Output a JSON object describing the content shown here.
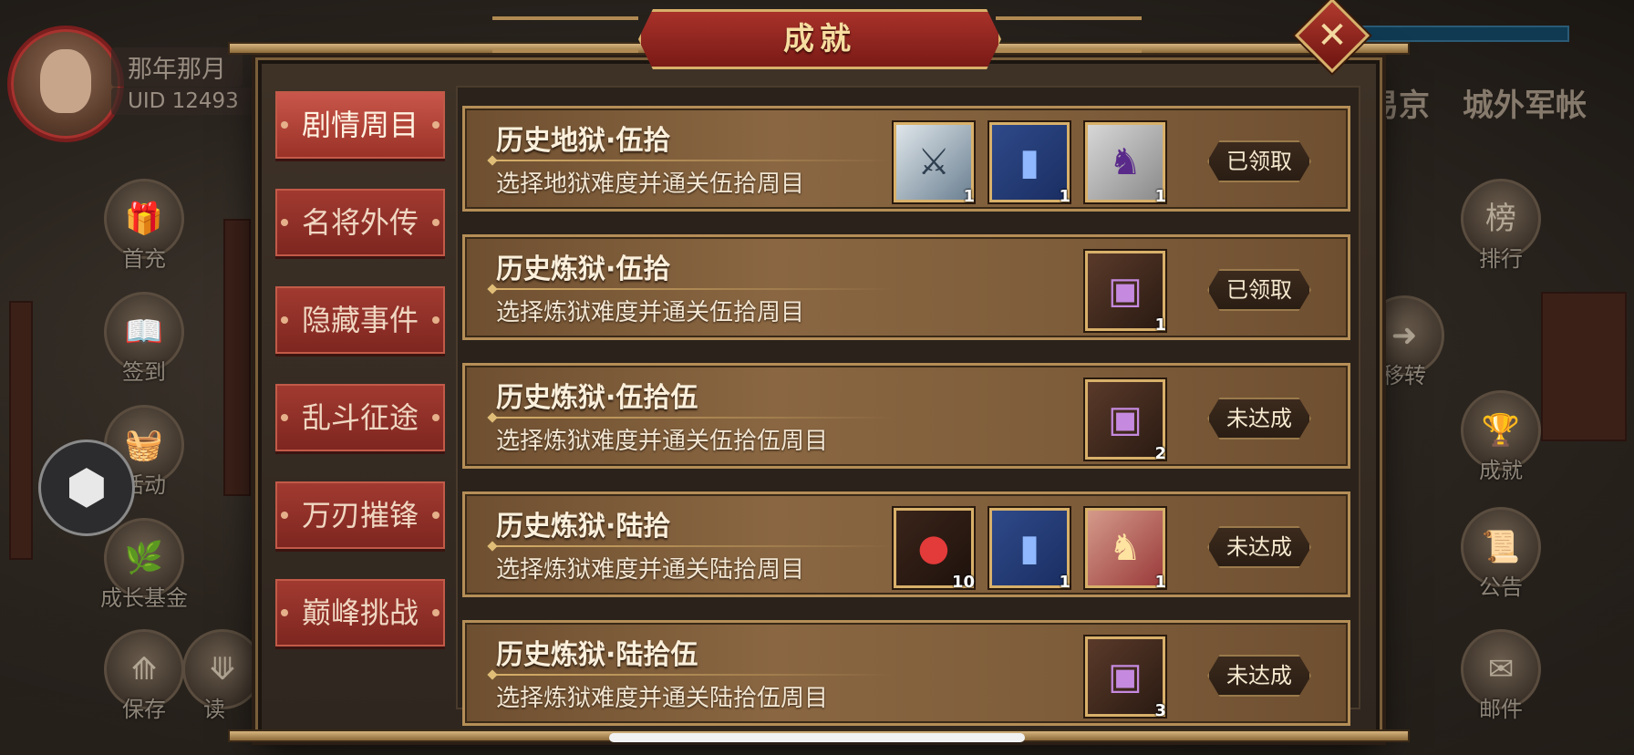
{
  "player": {
    "name": "那年那月",
    "uid": "UID  12493"
  },
  "background": {
    "locations": [
      "易京",
      "城外军帐"
    ],
    "left_menu": [
      {
        "label": "首充",
        "icon": "gift-icon"
      },
      {
        "label": "签到",
        "icon": "book-icon"
      },
      {
        "label": "活动",
        "icon": "basket-icon"
      },
      {
        "label": "成长基金",
        "icon": "plant-icon"
      },
      {
        "label": "保存",
        "icon": "save-icon"
      },
      {
        "label": "读",
        "icon": "load-icon"
      }
    ],
    "right_menu": [
      {
        "label": "排行",
        "icon": "ranking-icon"
      },
      {
        "label": "移转",
        "icon": "transfer-icon"
      },
      {
        "label": "成就",
        "icon": "achievement-icon"
      },
      {
        "label": "公告",
        "icon": "announcement-icon"
      },
      {
        "label": "邮件",
        "icon": "mail-icon"
      }
    ]
  },
  "modal": {
    "title": "成就",
    "close_symbol": "✕",
    "tabs": [
      {
        "label": "剧情周目",
        "active": true
      },
      {
        "label": "名将外传",
        "active": false
      },
      {
        "label": "隐藏事件",
        "active": false
      },
      {
        "label": "乱斗征途",
        "active": false
      },
      {
        "label": "万刃摧锋",
        "active": false
      },
      {
        "label": "巅峰挑战",
        "active": false
      }
    ],
    "achievements": [
      {
        "title": "历史地狱·伍拾",
        "description": "选择地狱难度并通关伍拾周目",
        "status": "已领取",
        "rewards": [
          {
            "icon": "crossed-weapons-icon",
            "qty": "1"
          },
          {
            "icon": "blue-scroll-icon",
            "qty": "1"
          },
          {
            "icon": "general-portrait-icon",
            "qty": "1"
          }
        ]
      },
      {
        "title": "历史炼狱·伍拾",
        "description": "选择炼狱难度并通关伍拾周目",
        "status": "已领取",
        "rewards": [
          {
            "icon": "treasure-chest-icon",
            "qty": "1"
          }
        ]
      },
      {
        "title": "历史炼狱·伍拾伍",
        "description": "选择炼狱难度并通关伍拾伍周目",
        "status": "未达成",
        "rewards": [
          {
            "icon": "treasure-chest-icon",
            "qty": "2"
          }
        ]
      },
      {
        "title": "历史炼狱·陆拾",
        "description": "选择炼狱难度并通关陆拾周目",
        "status": "未达成",
        "rewards": [
          {
            "icon": "red-berries-icon",
            "qty": "10"
          },
          {
            "icon": "blue-scroll-icon",
            "qty": "1"
          },
          {
            "icon": "general-portrait-red-icon",
            "qty": "1"
          }
        ]
      },
      {
        "title": "历史炼狱·陆拾伍",
        "description": "选择炼狱难度并通关陆拾伍周目",
        "status": "未达成",
        "rewards": [
          {
            "icon": "treasure-chest-icon",
            "qty": "3"
          }
        ]
      }
    ]
  }
}
